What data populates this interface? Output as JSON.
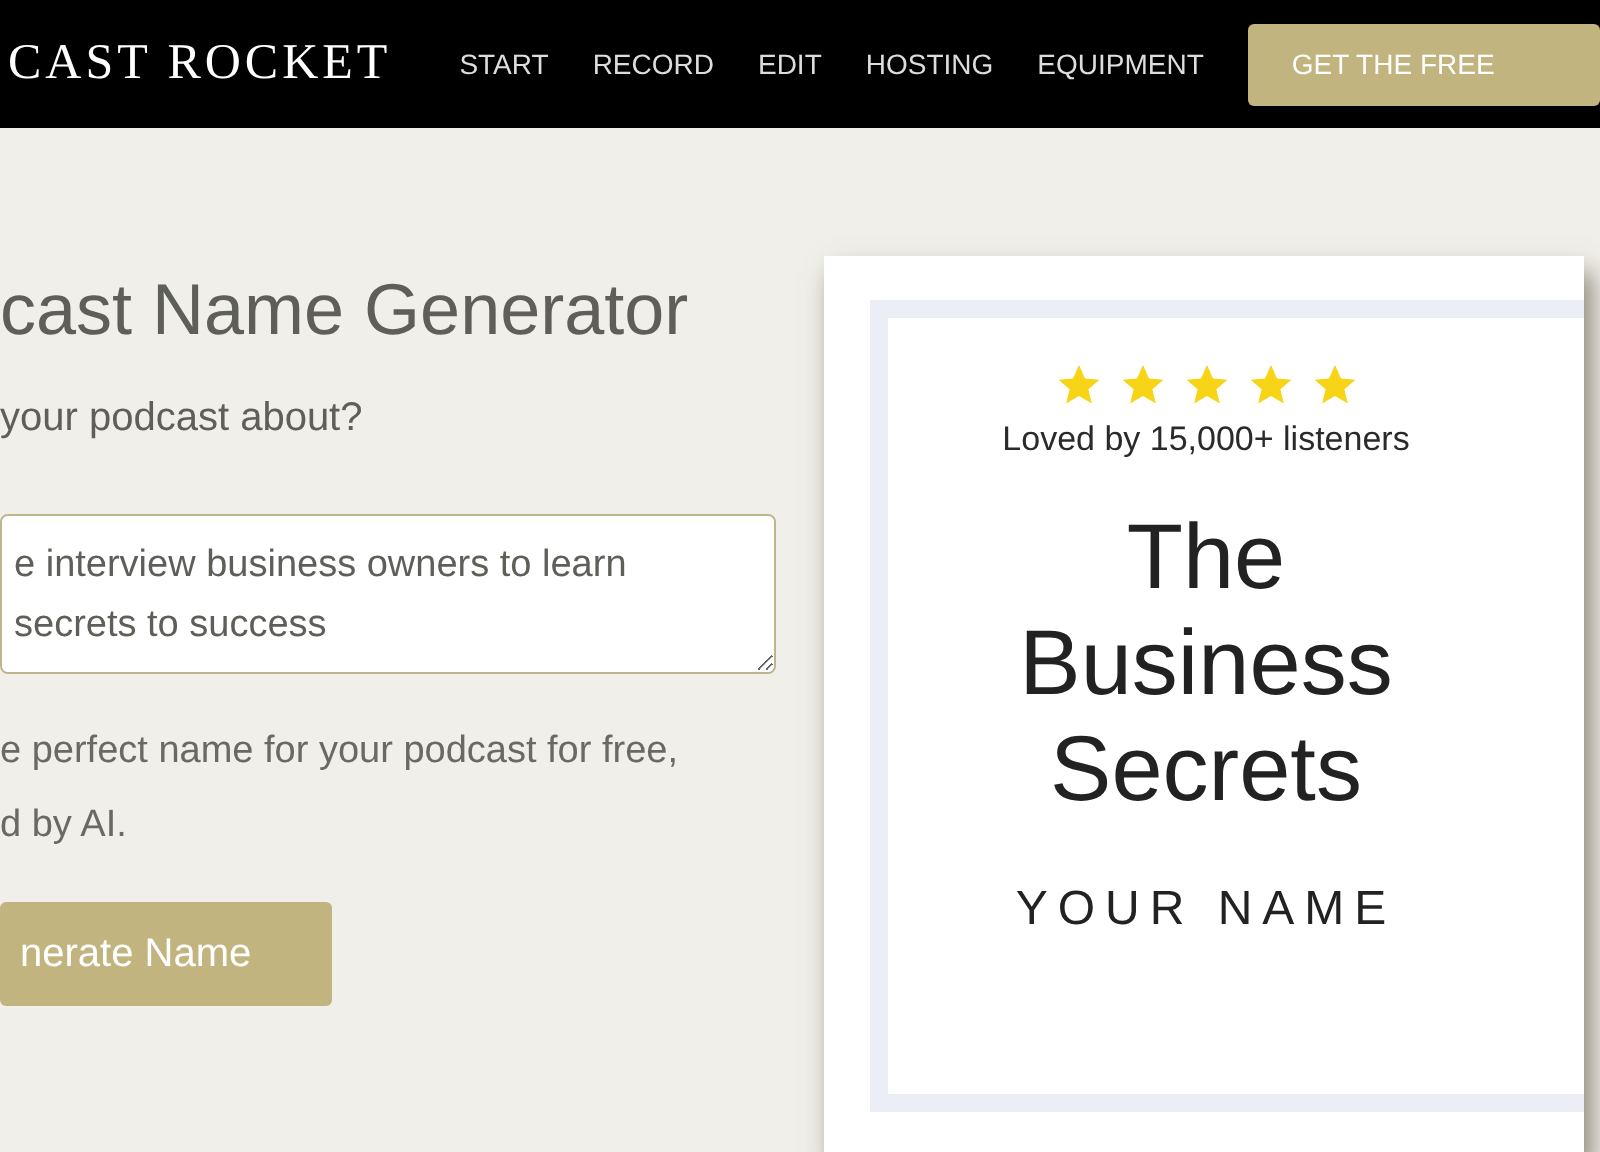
{
  "header": {
    "logo": "CAST ROCKET",
    "nav": [
      "START",
      "RECORD",
      "EDIT",
      "HOSTING",
      "EQUIPMENT"
    ],
    "cta": "GET THE FREE"
  },
  "generator": {
    "title": "cast Name Generator",
    "question": "your podcast about?",
    "input_value": "e interview business owners to learn\nsecrets to success",
    "description_lines": [
      "e perfect name for your podcast for free,",
      "d by AI."
    ],
    "button": "nerate Name"
  },
  "cover": {
    "stars": 5,
    "rating_text": "Loved by 15,000+ listeners",
    "title": "The Business Secrets",
    "author": "YOUR NAME"
  }
}
